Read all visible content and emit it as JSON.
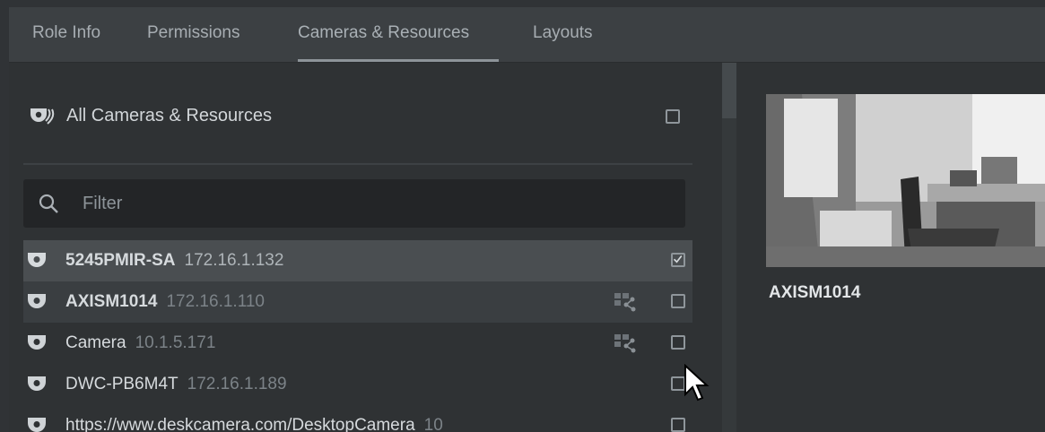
{
  "tabs": [
    {
      "label": "Role Info",
      "active": false
    },
    {
      "label": "Permissions",
      "active": false
    },
    {
      "label": "Cameras & Resources",
      "active": true
    },
    {
      "label": "Layouts",
      "active": false
    }
  ],
  "all_cameras": {
    "label": "All Cameras & Resources",
    "checked": false,
    "icon": "cameras-group-icon"
  },
  "filter": {
    "placeholder": "Filter",
    "value": "",
    "icon": "search-icon"
  },
  "cameras": [
    {
      "name": "5245PMIR-SA",
      "ip": "172.16.1.132",
      "checked": true,
      "shared": false,
      "selected": true,
      "icon": "dome-camera-icon"
    },
    {
      "name": "AXISM1014",
      "ip": "172.16.1.110",
      "checked": false,
      "shared": true,
      "hovered": true,
      "icon": "dome-camera-icon"
    },
    {
      "name": "Camera",
      "ip": "10.1.5.171",
      "checked": false,
      "shared": true,
      "icon": "dome-camera-icon"
    },
    {
      "name": "DWC-PB6M4T",
      "ip": "172.16.1.189",
      "checked": false,
      "shared": false,
      "icon": "dome-camera-icon"
    },
    {
      "name": "https://www.deskcamera.com/DesktopCamera",
      "ip": "10",
      "checked": false,
      "shared": false,
      "icon": "dome-camera-icon"
    }
  ],
  "preview": {
    "camera_name": "AXISM1014"
  },
  "colors": {
    "background": "#2f3234",
    "tab_bar": "#3c4043",
    "selected_row": "#4a4e51",
    "hover_row": "#3a3e41",
    "filter_bg": "#232527"
  }
}
